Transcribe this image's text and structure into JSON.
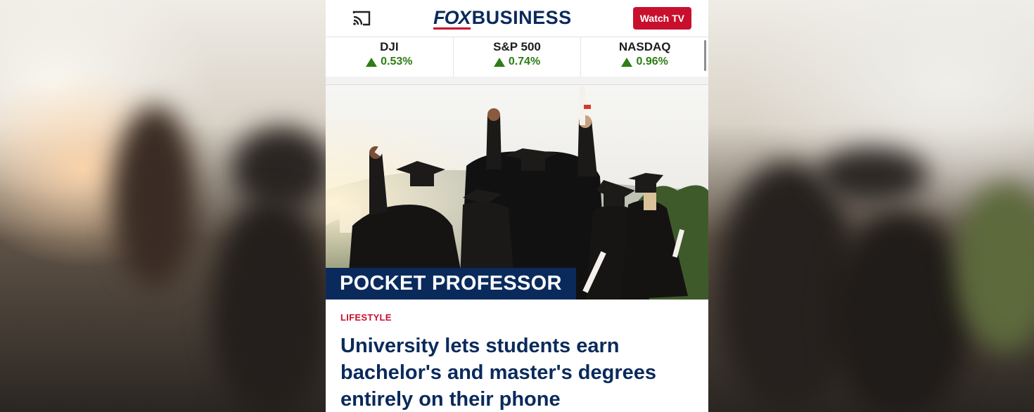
{
  "header": {
    "cast_icon": "cast-icon",
    "logo_part1": "FOX",
    "logo_part2": "BUSINESS",
    "watch_label": "Watch TV"
  },
  "tickers": [
    {
      "name": "DJI",
      "change": "0.53%",
      "direction": "up"
    },
    {
      "name": "S&P 500",
      "change": "0.74%",
      "direction": "up"
    },
    {
      "name": "NASDAQ",
      "change": "0.96%",
      "direction": "up"
    }
  ],
  "hero": {
    "banner": "POCKET PROFESSOR"
  },
  "article": {
    "category": "LIFESTYLE",
    "headline": "University lets students earn bachelor's and master's degrees entirely on their phone"
  },
  "colors": {
    "brand_navy": "#0a2a5c",
    "brand_red": "#c8102e",
    "ticker_up": "#2e7d15"
  }
}
